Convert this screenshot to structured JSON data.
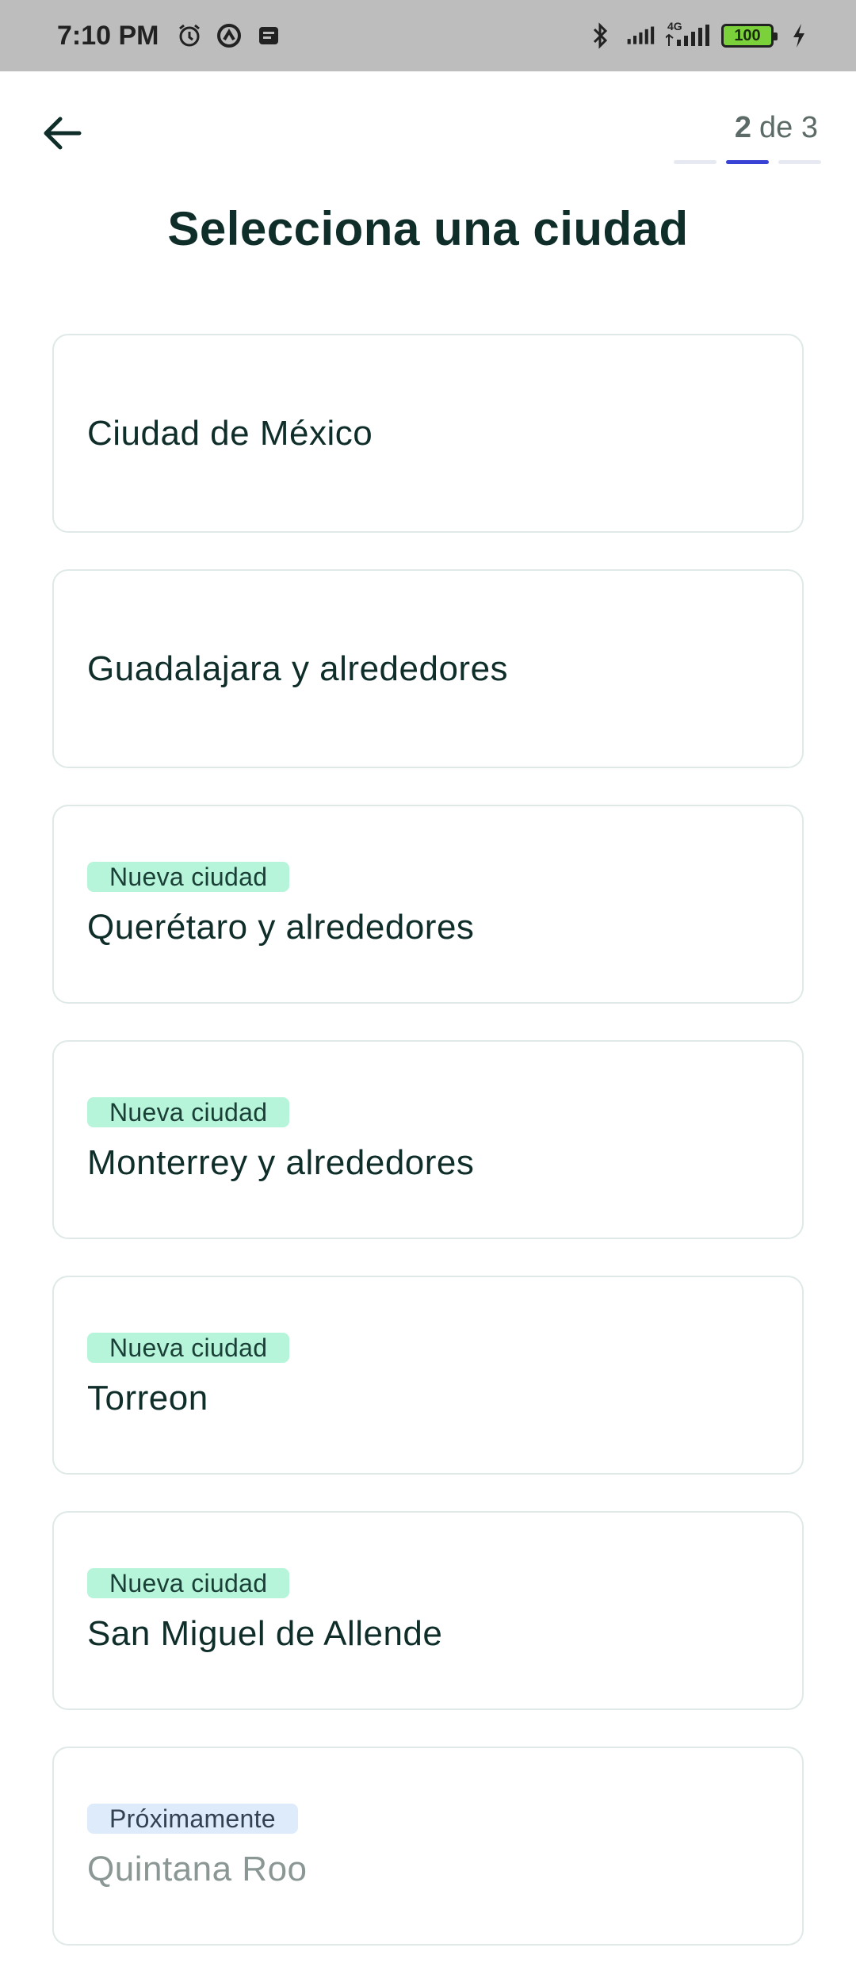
{
  "status_bar": {
    "time": "7:10 PM",
    "battery_level": "100",
    "network_label": "4G",
    "icons": [
      "alarm-icon",
      "vpn-icon",
      "notification-icon",
      "bluetooth-icon",
      "signal-icon",
      "signal-4g-icon",
      "battery-icon",
      "charging-icon"
    ]
  },
  "header": {
    "back_icon": "arrow-left-icon",
    "step_current": "2",
    "step_of": "de 3",
    "steps_total": 3,
    "steps_active_index": 2
  },
  "title": "Selecciona una ciudad",
  "cities": [
    {
      "name": "Ciudad de México",
      "badge": ""
    },
    {
      "name": "Guadalajara y alrededores",
      "badge": ""
    },
    {
      "name": "Querétaro y alrededores",
      "badge": "Nueva ciudad"
    },
    {
      "name": "Monterrey y alrededores",
      "badge": "Nueva ciudad"
    },
    {
      "name": "Torreon",
      "badge": "Nueva ciudad"
    },
    {
      "name": "San Miguel de Allende",
      "badge": "Nueva ciudad"
    },
    {
      "name": "Quintana Roo",
      "badge": "Próximamente"
    }
  ],
  "colors": {
    "accent": "#3843d6",
    "badge_new_bg": "#b6f5da",
    "badge_soon_bg": "#deebfb",
    "text_dark": "#0f2e2a",
    "text_disabled": "#8a9794"
  }
}
